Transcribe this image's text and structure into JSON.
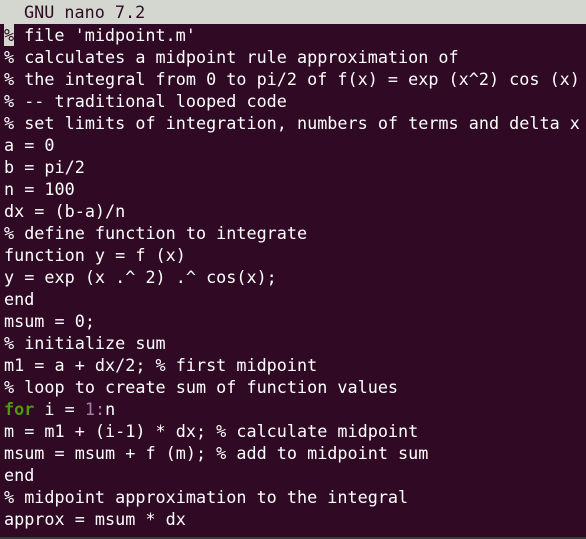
{
  "app": {
    "title": "GNU nano 7.2"
  },
  "colors": {
    "background": "#300a24",
    "foreground": "#ffffff",
    "titlebar_bg": "#d3d7cf",
    "keyword": "#4e9a06",
    "number": "#ad7fa8"
  },
  "editor": {
    "cursor_char": "%",
    "line1_rest": " file 'midpoint.m'",
    "lines": [
      "% calculates a midpoint rule approximation of",
      "% the integral from 0 to pi/2 of f(x) = exp (x^2) cos (x)",
      "% -- traditional looped code",
      "% set limits of integration, numbers of terms and delta x",
      "a = 0",
      "b = pi/2",
      "n = 100",
      "dx = (b-a)/n",
      "% define function to integrate",
      "function y = f (x)",
      "y = exp (x .^ 2) .^ cos(x);",
      "end",
      "msum = 0;",
      "% initialize sum",
      "m1 = a + dx/2; % first midpoint",
      "% loop to create sum of function values"
    ],
    "for_line": {
      "keyword": "for",
      "middle": " i = ",
      "range": "1:",
      "end": "n"
    },
    "lines_after": [
      "m = m1 + (i-1) * dx; % calculate midpoint",
      "msum = msum + f (m); % add to midpoint sum",
      "end",
      "% midpoint approximation to the integral",
      "approx = msum * dx"
    ]
  }
}
